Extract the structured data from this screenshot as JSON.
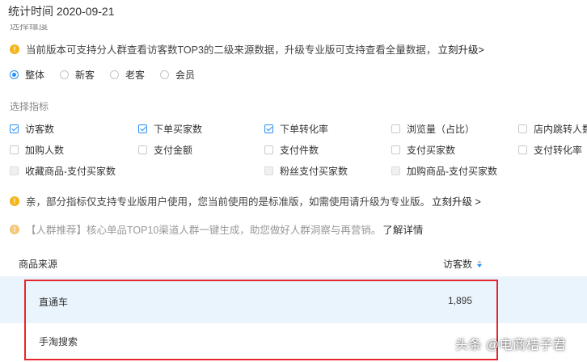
{
  "header": {
    "stat_time": "统计时间 2020-09-21"
  },
  "dimension": {
    "section_label": "选择维度",
    "notice_text": "当前版本可支持分人群查看访客数TOP3的二级来源数据，升级专业版可支持查看全量数据，",
    "notice_link": "立刻升级>",
    "options": [
      {
        "label": "整体",
        "selected": true
      },
      {
        "label": "新客",
        "selected": false
      },
      {
        "label": "老客",
        "selected": false
      },
      {
        "label": "会员",
        "selected": false
      }
    ]
  },
  "metrics": {
    "section_label": "选择指标",
    "rows": [
      [
        {
          "label": "访客数",
          "checked": true,
          "disabled": false
        },
        {
          "label": "下单买家数",
          "checked": true,
          "disabled": false
        },
        {
          "label": "下单转化率",
          "checked": true,
          "disabled": false
        },
        {
          "label": "浏览量（占比）",
          "checked": false,
          "disabled": false
        },
        {
          "label": "店内跳转人数",
          "checked": false,
          "disabled": false
        }
      ],
      [
        {
          "label": "加购人数",
          "checked": false,
          "disabled": false
        },
        {
          "label": "支付金额",
          "checked": false,
          "disabled": false
        },
        {
          "label": "支付件数",
          "checked": false,
          "disabled": false
        },
        {
          "label": "支付买家数",
          "checked": false,
          "disabled": false
        },
        {
          "label": "支付转化率",
          "checked": false,
          "disabled": false
        }
      ],
      [
        {
          "label": "收藏商品-支付买家数",
          "checked": false,
          "disabled": true
        },
        {
          "label": "粉丝支付买家数",
          "checked": false,
          "disabled": true
        },
        {
          "label": "加购商品-支付买家数",
          "checked": false,
          "disabled": true
        }
      ]
    ],
    "notice_text": "亲，部分指标仅支持专业版用户使用，您当前使用的是标准版，如需使用请升级为专业版。",
    "notice_link": "立刻升级 >"
  },
  "promo": {
    "text": "【人群推荐】核心单品TOP10渠道人群一键生成，助您做好人群洞察与再营销。",
    "link": "了解详情"
  },
  "table": {
    "col_source": "商品来源",
    "col_visits": "访客数",
    "rows": [
      {
        "source": "直通车",
        "visits": "1,895"
      },
      {
        "source": "手淘搜索",
        "visits": ""
      }
    ]
  },
  "watermark": "头条 @电商桔子君",
  "colors": {
    "accent": "#2b8ff5",
    "warning": "#f4b41a",
    "highlight": "#e6262e",
    "row_bg": "#eaf4fc"
  }
}
